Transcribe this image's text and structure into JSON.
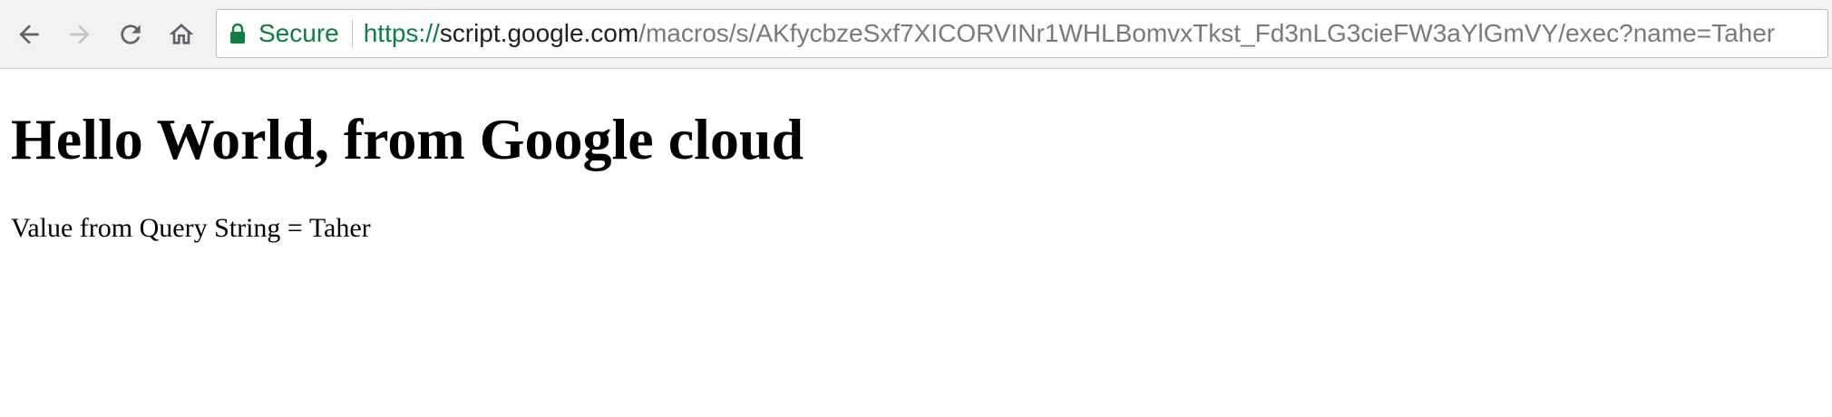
{
  "browser": {
    "nav": {
      "back_icon": "arrow-left-icon",
      "forward_icon": "arrow-right-icon",
      "reload_icon": "reload-icon",
      "home_icon": "home-icon"
    },
    "address_bar": {
      "security_label": "Secure",
      "security_icon": "lock-icon",
      "security_color": "#0b8043",
      "url_scheme": "https://",
      "url_host": "script.google.com",
      "url_path": "/macros/s/AKfycbzeSxf7XICORVINr1WHLBomvxTkst_Fd3nLG3cieFW3aYlGmVY/exec?name=Taher"
    }
  },
  "page": {
    "heading": "Hello World, from Google cloud",
    "query_line": "Value from Query String = Taher"
  }
}
